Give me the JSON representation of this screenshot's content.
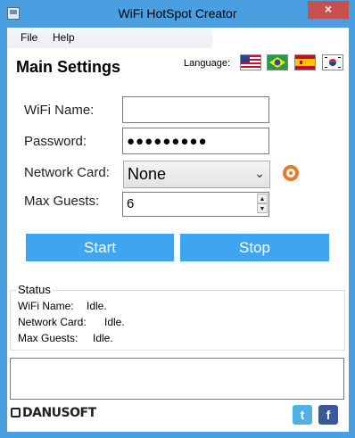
{
  "window": {
    "title": "WiFi HotSpot Creator",
    "close_glyph": "×",
    "app_icon": "wifi-app-icon"
  },
  "menu": [
    {
      "label": "File"
    },
    {
      "label": "Help"
    }
  ],
  "header": {
    "title": "Main Settings",
    "language_label": "Language:",
    "flags": [
      {
        "name": "us-flag-icon"
      },
      {
        "name": "brazil-flag-icon"
      },
      {
        "name": "spain-flag-icon"
      },
      {
        "name": "korea-flag-icon"
      }
    ]
  },
  "form": {
    "wifi_name_label": "WiFi Name:",
    "wifi_name_value": "",
    "password_label": "Password:",
    "password_value": "●●●●●●●●●",
    "network_card_label": "Network Card:",
    "network_card_selected": "None",
    "max_guests_label": "Max Guests:",
    "max_guests_value": "6"
  },
  "actions": {
    "start_label": "Start",
    "stop_label": "Stop"
  },
  "status": {
    "title": "Status",
    "wifi_name_label": "WiFi Name:",
    "wifi_name_value": "Idle.",
    "network_card_label": "Network Card:",
    "network_card_value": "Idle.",
    "max_guests_label": "Max Guests:",
    "max_guests_value": "Idle."
  },
  "footer": {
    "logo_text": "DANUSOFT",
    "twitter_glyph": "t",
    "facebook_glyph": "f"
  },
  "colors": {
    "window_frame": "#4a9fe0",
    "button": "#3ea6f0",
    "close": "#c7504c",
    "refresh": "#e57a2a",
    "twitter": "#4fb2e4",
    "facebook": "#3b5998"
  }
}
